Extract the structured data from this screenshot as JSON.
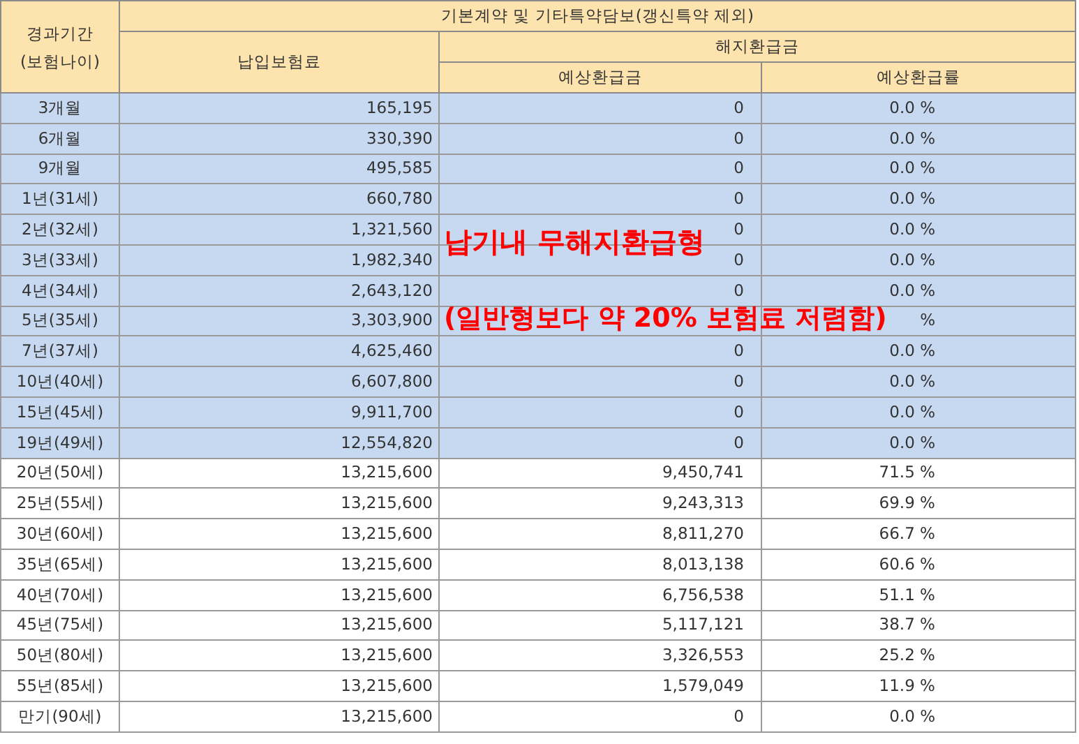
{
  "table": {
    "header": {
      "period": "경과기간\n(보험나이)",
      "group": "기본계약 및 기타특약담보(갱신특약 제외)",
      "premium": "납입보험료",
      "surrender": "해지환급금",
      "refund": "예상환급금",
      "rate": "예상환급률"
    },
    "rows": [
      {
        "period": "3개월",
        "premium": "165,195",
        "refund": "0",
        "rate": "0.0 %",
        "shaded": true
      },
      {
        "period": "6개월",
        "premium": "330,390",
        "refund": "0",
        "rate": "0.0 %",
        "shaded": true
      },
      {
        "period": "9개월",
        "premium": "495,585",
        "refund": "0",
        "rate": "0.0 %",
        "shaded": true
      },
      {
        "period": "1년(31세)",
        "premium": "660,780",
        "refund": "0",
        "rate": "0.0 %",
        "shaded": true
      },
      {
        "period": "2년(32세)",
        "premium": "1,321,560",
        "refund": "0",
        "rate": "0.0 %",
        "shaded": true
      },
      {
        "period": "3년(33세)",
        "premium": "1,982,340",
        "refund": "0",
        "rate": "0.0 %",
        "shaded": true
      },
      {
        "period": "4년(34세)",
        "premium": "2,643,120",
        "refund": "0",
        "rate": "0.0 %",
        "shaded": true
      },
      {
        "period": "5년(35세)",
        "premium": "3,303,900",
        "rate": "%",
        "shaded": true
      },
      {
        "period": "7년(37세)",
        "premium": "4,625,460",
        "refund": "0",
        "rate": "0.0 %",
        "shaded": true
      },
      {
        "period": "10년(40세)",
        "premium": "6,607,800",
        "refund": "0",
        "rate": "0.0 %",
        "shaded": true
      },
      {
        "period": "15년(45세)",
        "premium": "9,911,700",
        "refund": "0",
        "rate": "0.0 %",
        "shaded": true
      },
      {
        "period": "19년(49세)",
        "premium": "12,554,820",
        "refund": "0",
        "rate": "0.0 %",
        "shaded": true
      },
      {
        "period": "20년(50세)",
        "premium": "13,215,600",
        "refund": "9,450,741",
        "rate": "71.5 %",
        "shaded": false
      },
      {
        "period": "25년(55세)",
        "premium": "13,215,600",
        "refund": "9,243,313",
        "rate": "69.9 %",
        "shaded": false
      },
      {
        "period": "30년(60세)",
        "premium": "13,215,600",
        "refund": "8,811,270",
        "rate": "66.7 %",
        "shaded": false
      },
      {
        "period": "35년(65세)",
        "premium": "13,215,600",
        "refund": "8,013,138",
        "rate": "60.6 %",
        "shaded": false
      },
      {
        "period": "40년(70세)",
        "premium": "13,215,600",
        "refund": "6,756,538",
        "rate": "51.1 %",
        "shaded": false
      },
      {
        "period": "45년(75세)",
        "premium": "13,215,600",
        "refund": "5,117,121",
        "rate": "38.7 %",
        "shaded": false
      },
      {
        "period": "50년(80세)",
        "premium": "13,215,600",
        "refund": "3,326,553",
        "rate": "25.2 %",
        "shaded": false
      },
      {
        "period": "55년(85세)",
        "premium": "13,215,600",
        "refund": "1,579,049",
        "rate": "11.9 %",
        "shaded": false
      },
      {
        "period": "만기(90세)",
        "premium": "13,215,600",
        "refund": "0",
        "rate": "0.0 %",
        "shaded": false
      }
    ]
  },
  "overlay": {
    "title": "납기내 무해지환급형",
    "note": "(일반형보다 약 20% 보험료 저렴함)"
  }
}
